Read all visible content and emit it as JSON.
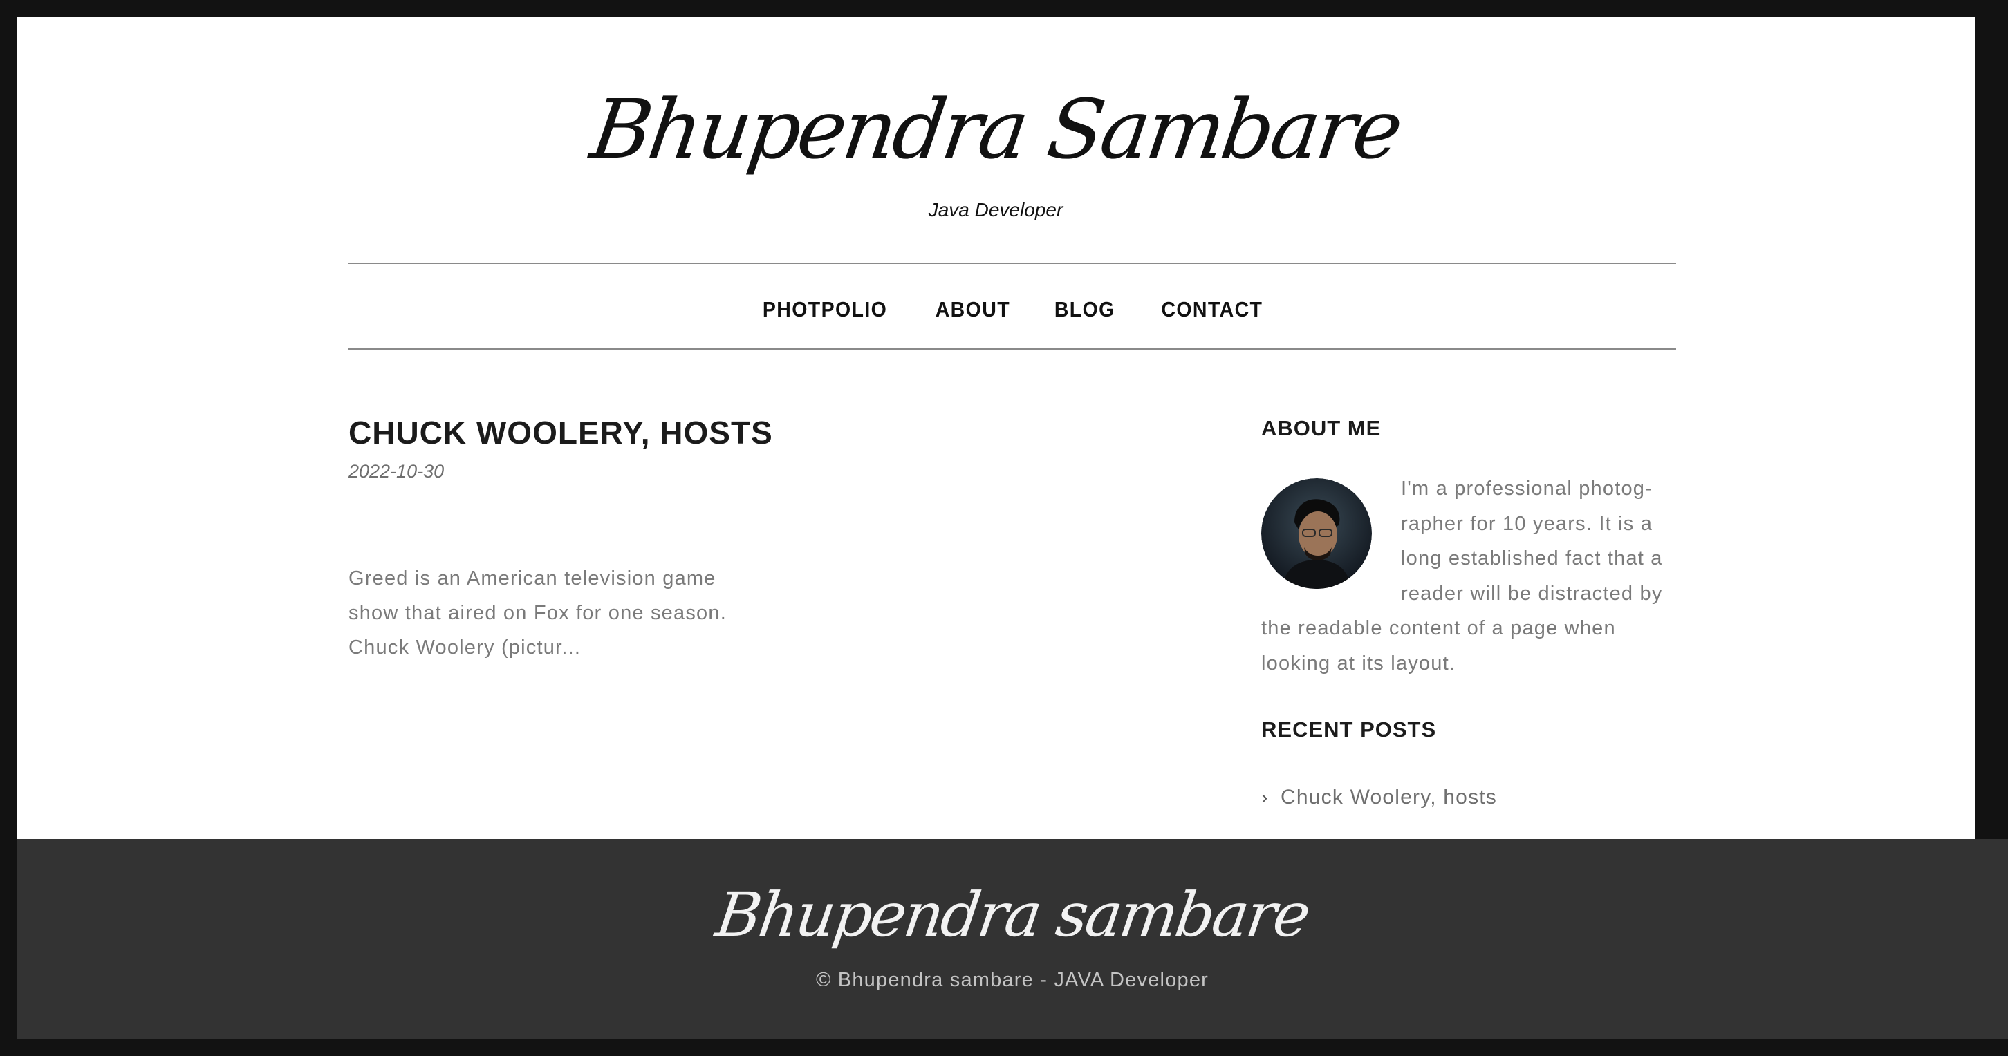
{
  "colors": {
    "outer_frame": "#121212",
    "page_background": "#ffffff",
    "footer_background": "#333333",
    "heading_text": "#1b1b1b",
    "body_text": "#7a7a7a",
    "divider": "#8a8a8a"
  },
  "header": {
    "site_title": "Bhupendra Sambare",
    "subtitle": "Java Developer"
  },
  "nav": {
    "items": [
      {
        "label": "PHOTPOLIO"
      },
      {
        "label": "ABOUT"
      },
      {
        "label": "BLOG"
      },
      {
        "label": "CONTACT"
      }
    ]
  },
  "post": {
    "title": "CHUCK WOOLERY, HOSTS",
    "date": "2022-10-30",
    "excerpt": "Greed is an American television game show that aired on Fox for one season. Chuck Woolery (pictur..."
  },
  "sidebar": {
    "about_title": "ABOUT ME",
    "about_text": "I'm a professional photog­rapher for 10 years. It is a long established fact that a reader will be distracted by the readable content of a page when looking at its layout.",
    "avatar_icon": "profile-photo",
    "recent_title": "RECENT POSTS",
    "recent_posts": [
      {
        "label": "Chuck Woolery, hosts",
        "icon": "chevron-right-icon"
      }
    ]
  },
  "footer": {
    "logo": "Bhupendra sambare",
    "copyright": "© Bhupendra sambare - JAVA Developer"
  }
}
